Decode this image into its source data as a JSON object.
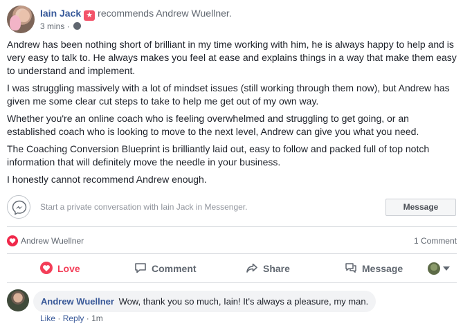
{
  "post": {
    "author": "Iain Jack",
    "recommends_text": "recommends",
    "target": "Andrew Wuellner.",
    "time": "3 mins",
    "separator": "·",
    "privacy_icon": "globe-icon",
    "paragraphs": [
      "Andrew has been nothing short of brilliant in my time working with him, he is always happy to help and is very easy to talk to. He always makes you feel at ease and explains things in a way that make them easy to understand and implement.",
      "I was struggling massively with a lot of mindset issues (still working through them now), but Andrew has given me some clear cut steps to take to help me get out of my own way.",
      "Whether you're an online coach who is feeling overwhelmed and struggling to get going, or an established coach who is looking to move to the next level, Andrew can give you what you need.",
      "The Coaching Conversion Blueprint is brilliantly laid out, easy to follow and packed full of top notch information that will definitely move the needle in your business.",
      "I honestly cannot recommend Andrew enough."
    ]
  },
  "messenger": {
    "prompt": "Start a private conversation with Iain Jack in Messenger.",
    "button_label": "Message"
  },
  "reactions": {
    "reactor": "Andrew Wuellner",
    "comment_count": "1 Comment"
  },
  "actions": {
    "love": "Love",
    "comment": "Comment",
    "share": "Share",
    "message": "Message"
  },
  "comment": {
    "author": "Andrew Wuellner",
    "text": "Wow, thank you so much, Iain! It's always a pleasure, my man.",
    "like": "Like",
    "dot1": "·",
    "reply": "Reply",
    "dot2": "·",
    "time": "1m"
  },
  "colors": {
    "link": "#365899",
    "love": "#f33e58",
    "muted": "#606770"
  }
}
